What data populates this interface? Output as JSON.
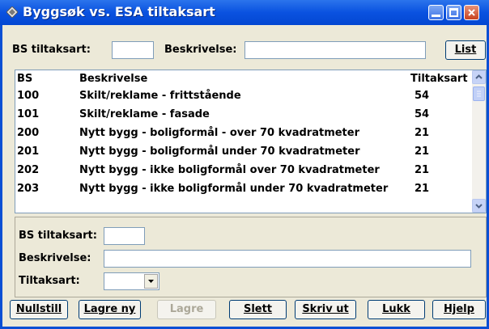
{
  "window": {
    "title": "Byggsøk vs. ESA tiltaksart"
  },
  "search": {
    "bs_label": "BS tiltaksart:",
    "bs_value": "",
    "desc_label": "Beskrivelse:",
    "desc_value": "",
    "list_button": "List"
  },
  "table": {
    "columns": [
      "BS",
      "Beskrivelse",
      "Tiltaksart"
    ],
    "rows": [
      {
        "bs": "100",
        "desc": "Skilt/reklame - frittstående",
        "code": "54"
      },
      {
        "bs": "101",
        "desc": "Skilt/reklame - fasade",
        "code": "54"
      },
      {
        "bs": "200",
        "desc": "Nytt bygg - boligformål - over 70 kvadratmeter",
        "code": "21"
      },
      {
        "bs": "201",
        "desc": "Nytt bygg - boligformål under 70 kvadratmeter",
        "code": "21"
      },
      {
        "bs": "202",
        "desc": "Nytt bygg - ikke boligformål over 70 kvadratmeter",
        "code": "21"
      },
      {
        "bs": "203",
        "desc": "Nytt bygg - ikke boligformål under 70 kvadratmeter",
        "code": "21"
      }
    ]
  },
  "detail": {
    "bs_label": "BS tiltaksart:",
    "bs_value": "",
    "desc_label": "Beskrivelse:",
    "desc_value": "",
    "tiltak_label": "Tiltaksart:",
    "tiltak_value": ""
  },
  "buttons": {
    "reset": "Nullstill",
    "save_new": "Lagre ny",
    "save": "Lagre",
    "delete": "Slett",
    "print": "Skriv ut",
    "close": "Lukk",
    "help": "Hjelp"
  },
  "colors": {
    "titlebar": "#0a52e0",
    "window_bg": "#ece9d8",
    "border": "#7f9db9"
  }
}
